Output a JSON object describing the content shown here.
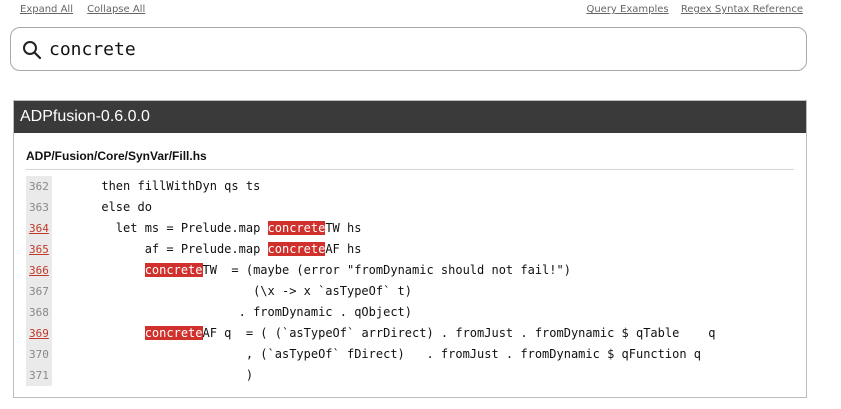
{
  "top_links": {
    "expand_all": "Expand All",
    "collapse_all": "Collapse All",
    "query_examples": "Query Examples",
    "regex_reference": "Regex Syntax Reference"
  },
  "search": {
    "value": "concrete",
    "icon": "search-icon"
  },
  "result": {
    "package": "ADPfusion-0.6.0.0",
    "file": "ADP/Fusion/Core/SynVar/Fill.hs",
    "highlight_color": "#d0312d",
    "lines": [
      {
        "num": "362",
        "match": false,
        "parts": [
          {
            "t": "      then fillWithDyn qs ts"
          }
        ]
      },
      {
        "num": "363",
        "match": false,
        "parts": [
          {
            "t": "      else do"
          }
        ]
      },
      {
        "num": "364",
        "match": true,
        "parts": [
          {
            "t": "        let ms = Prelude.map "
          },
          {
            "t": "concrete",
            "hl": true
          },
          {
            "t": "TW hs"
          }
        ]
      },
      {
        "num": "365",
        "match": true,
        "parts": [
          {
            "t": "            af = Prelude.map "
          },
          {
            "t": "concrete",
            "hl": true
          },
          {
            "t": "AF hs"
          }
        ]
      },
      {
        "num": "366",
        "match": true,
        "parts": [
          {
            "t": "            "
          },
          {
            "t": "concrete",
            "hl": true
          },
          {
            "t": "TW  = (maybe (error \"fromDynamic should not fail!\")"
          }
        ]
      },
      {
        "num": "367",
        "match": false,
        "parts": [
          {
            "t": "                           (\\x -> x `asTypeOf` t)"
          }
        ]
      },
      {
        "num": "368",
        "match": false,
        "parts": [
          {
            "t": "                         . fromDynamic . qObject)"
          }
        ]
      },
      {
        "num": "369",
        "match": true,
        "parts": [
          {
            "t": "            "
          },
          {
            "t": "concrete",
            "hl": true
          },
          {
            "t": "AF q  = ( (`asTypeOf` arrDirect) . fromJust . fromDynamic $ qTable    q"
          }
        ]
      },
      {
        "num": "370",
        "match": false,
        "parts": [
          {
            "t": "                          , (`asTypeOf` fDirect)   . fromJust . fromDynamic $ qFunction q"
          }
        ]
      },
      {
        "num": "371",
        "match": false,
        "parts": [
          {
            "t": "                          )"
          }
        ]
      }
    ]
  }
}
